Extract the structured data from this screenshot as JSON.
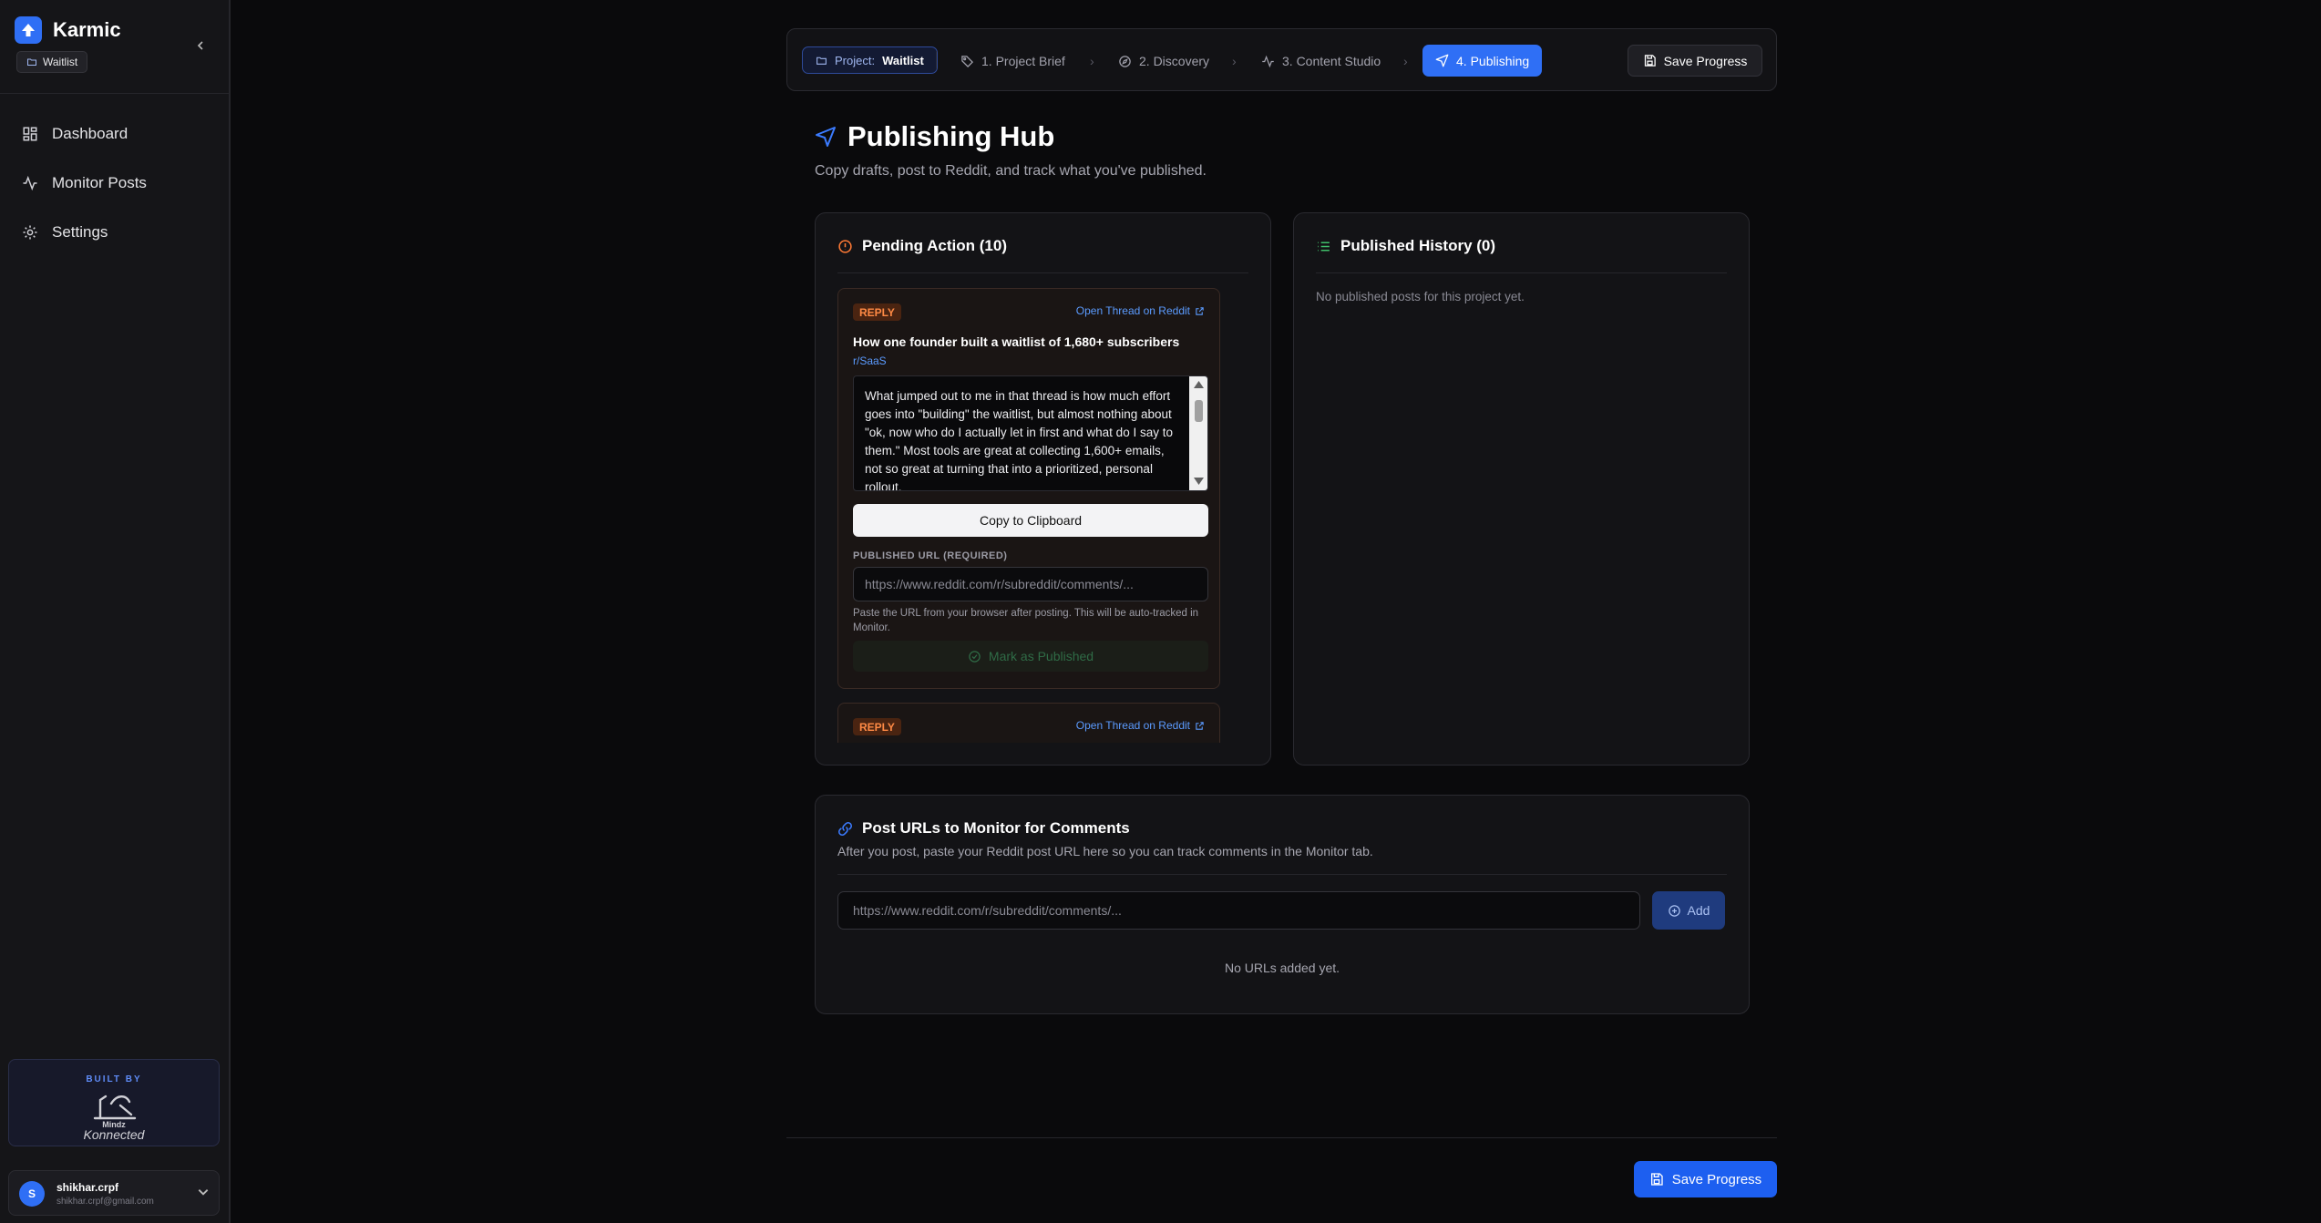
{
  "app": {
    "name": "Karmic",
    "project_chip": "Waitlist"
  },
  "nav": {
    "items": [
      "Dashboard",
      "Monitor Posts",
      "Settings"
    ]
  },
  "footer": {
    "built_by": "BUILT BY",
    "logo_text_top": "Mindz",
    "logo_text_bottom": "Konnected",
    "user_initial": "S",
    "user_name": "shikhar.crpf",
    "user_email": "shikhar.crpf@gmail.com"
  },
  "stepper": {
    "project_key": "Project:",
    "project_value": "Waitlist",
    "steps": [
      "1. Project Brief",
      "2. Discovery",
      "3. Content Studio",
      "4. Publishing"
    ],
    "save_label": "Save Progress"
  },
  "page": {
    "title": "Publishing Hub",
    "subtitle": "Copy drafts, post to Reddit, and track what you've published."
  },
  "pending": {
    "heading": "Pending Action (10)",
    "items": [
      {
        "badge": "REPLY",
        "link": "Open Thread on Reddit",
        "title": "How one founder built a waitlist of 1,680+ subscribers",
        "subreddit": "r/SaaS",
        "draft": "What jumped out to me in that thread is how much effort goes into \"building\" the waitlist, but almost nothing about \"ok, now who do I actually let in first and what do I say to them.\" Most tools are great at collecting 1,600+ emails, not so great at turning that into a prioritized, personal rollout.",
        "copy_label": "Copy to Clipboard",
        "url_label": "PUBLISHED URL (REQUIRED)",
        "url_placeholder": "https://www.reddit.com/r/subreddit/comments/...",
        "helper": "Paste the URL from your browser after posting. This will be auto-tracked in Monitor.",
        "mark_label": "Mark as Published"
      },
      {
        "badge": "REPLY",
        "link": "Open Thread on Reddit"
      }
    ]
  },
  "history": {
    "heading": "Published History (0)",
    "empty": "No published posts for this project yet."
  },
  "monitor": {
    "heading": "Post URLs to Monitor for Comments",
    "subtitle": "After you post, paste your Reddit post URL here so you can track comments in the Monitor tab.",
    "placeholder": "https://www.reddit.com/r/subreddit/comments/...",
    "add_label": "Add",
    "empty": "No URLs added yet."
  },
  "colors": {
    "accent": "#2f6ff5",
    "reply": "#ff8a45",
    "link": "#5b9bff",
    "published": "#2f6b46"
  }
}
